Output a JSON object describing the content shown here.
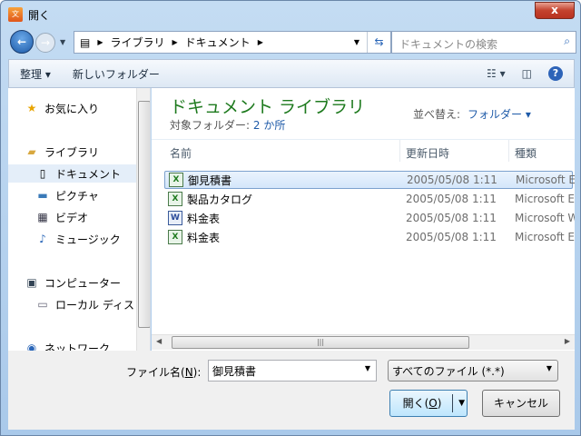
{
  "window": {
    "title": "開く",
    "close": "x"
  },
  "nav": {
    "breadcrumb": [
      "ライブラリ",
      "ドキュメント"
    ],
    "search_placeholder": "ドキュメントの検索"
  },
  "toolbar": {
    "organize": "整理 ▾",
    "new_folder": "新しいフォルダー"
  },
  "sidebar": {
    "items": [
      {
        "label": "お気に入り",
        "icon": "star-icon"
      },
      {
        "label": "ライブラリ",
        "icon": "library-icon"
      },
      {
        "label": "ドキュメント",
        "icon": "document-icon",
        "selected": true
      },
      {
        "label": "ピクチャ",
        "icon": "picture-icon"
      },
      {
        "label": "ビデオ",
        "icon": "video-icon"
      },
      {
        "label": "ミュージック",
        "icon": "music-icon"
      },
      {
        "label": "コンピューター",
        "icon": "computer-icon"
      },
      {
        "label": "ローカル ディス",
        "icon": "drive-icon"
      },
      {
        "label": "ネットワーク",
        "icon": "network-icon"
      }
    ]
  },
  "main": {
    "library_title": "ドキュメント ライブラリ",
    "target_label": "対象フォルダー:",
    "target_count": "2 か所",
    "sort_label": "並べ替え:",
    "sort_value": "フォルダー ▾",
    "columns": [
      "名前",
      "更新日時",
      "種類"
    ],
    "files": [
      {
        "name": "御見積書",
        "date": "2005/05/08 1:11",
        "type": "Microsoft Ex",
        "icon": "excel-icon",
        "selected": true
      },
      {
        "name": "製品カタログ",
        "date": "2005/05/08 1:11",
        "type": "Microsoft Ex",
        "icon": "excel-icon"
      },
      {
        "name": "料金表",
        "date": "2005/05/08 1:11",
        "type": "Microsoft W",
        "icon": "word-icon"
      },
      {
        "name": "料金表",
        "date": "2005/05/08 1:11",
        "type": "Microsoft Ex",
        "icon": "excel-icon"
      }
    ]
  },
  "bottom": {
    "filename_label": "ファイル名(",
    "filename_key": "N",
    "filename_label_end": "):",
    "filename_value": "御見積書",
    "filetype": "すべてのファイル (*.*)",
    "open_label": "開く(",
    "open_key": "O",
    "open_end": ")",
    "cancel": "キャンセル"
  }
}
